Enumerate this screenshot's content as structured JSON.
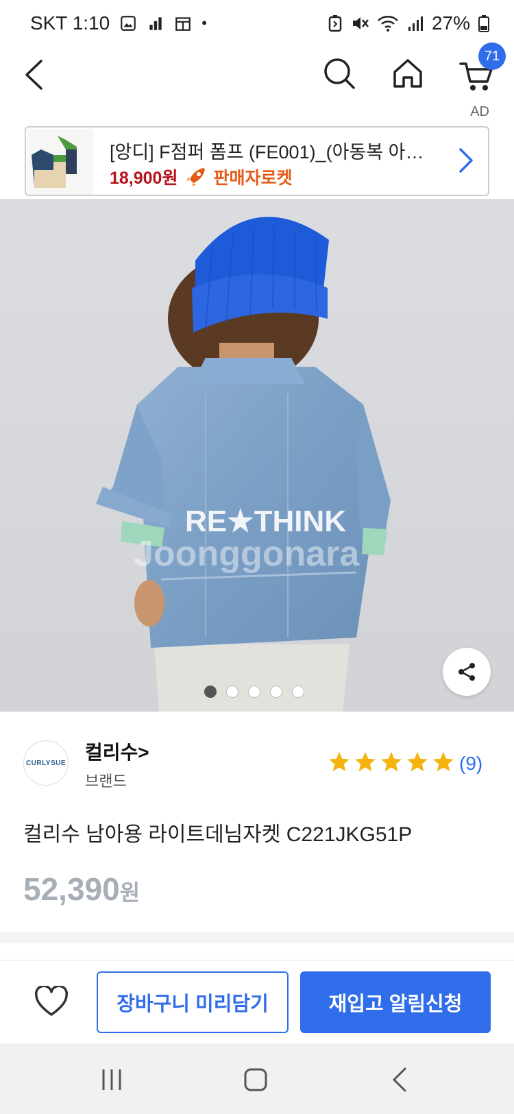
{
  "status": {
    "carrier_time": "SKT 1:10",
    "battery": "27%"
  },
  "nav": {
    "cart_count": "71"
  },
  "ad": {
    "label": "AD",
    "title": "[앙디] F점퍼 폼프 (FE001)_(아동복 아동…",
    "price": "18,900원",
    "seller_badge": "판매자로켓"
  },
  "gallery": {
    "image_count": 5,
    "active_index": 0,
    "jacket_text": "RE★THINK",
    "watermark": "Joonggonara"
  },
  "brand": {
    "logo_text": "CURLYSUE",
    "name": "컬리수>",
    "sub": "브랜드",
    "rating_stars": 5,
    "review_count": "(9)"
  },
  "product": {
    "title": "컬리수 남아용 라이트데님자켓 C221JKG51P",
    "price_number": "52,390",
    "price_unit": "원"
  },
  "actions": {
    "cart_label": "장바구니 미리담기",
    "restock_label": "재입고 알림신청"
  },
  "colors": {
    "accent": "#2f6dea",
    "ad_price": "#b5121b",
    "rocket": "#e45b17",
    "star": "#f5b30f",
    "price_muted": "#a7aeb8"
  }
}
